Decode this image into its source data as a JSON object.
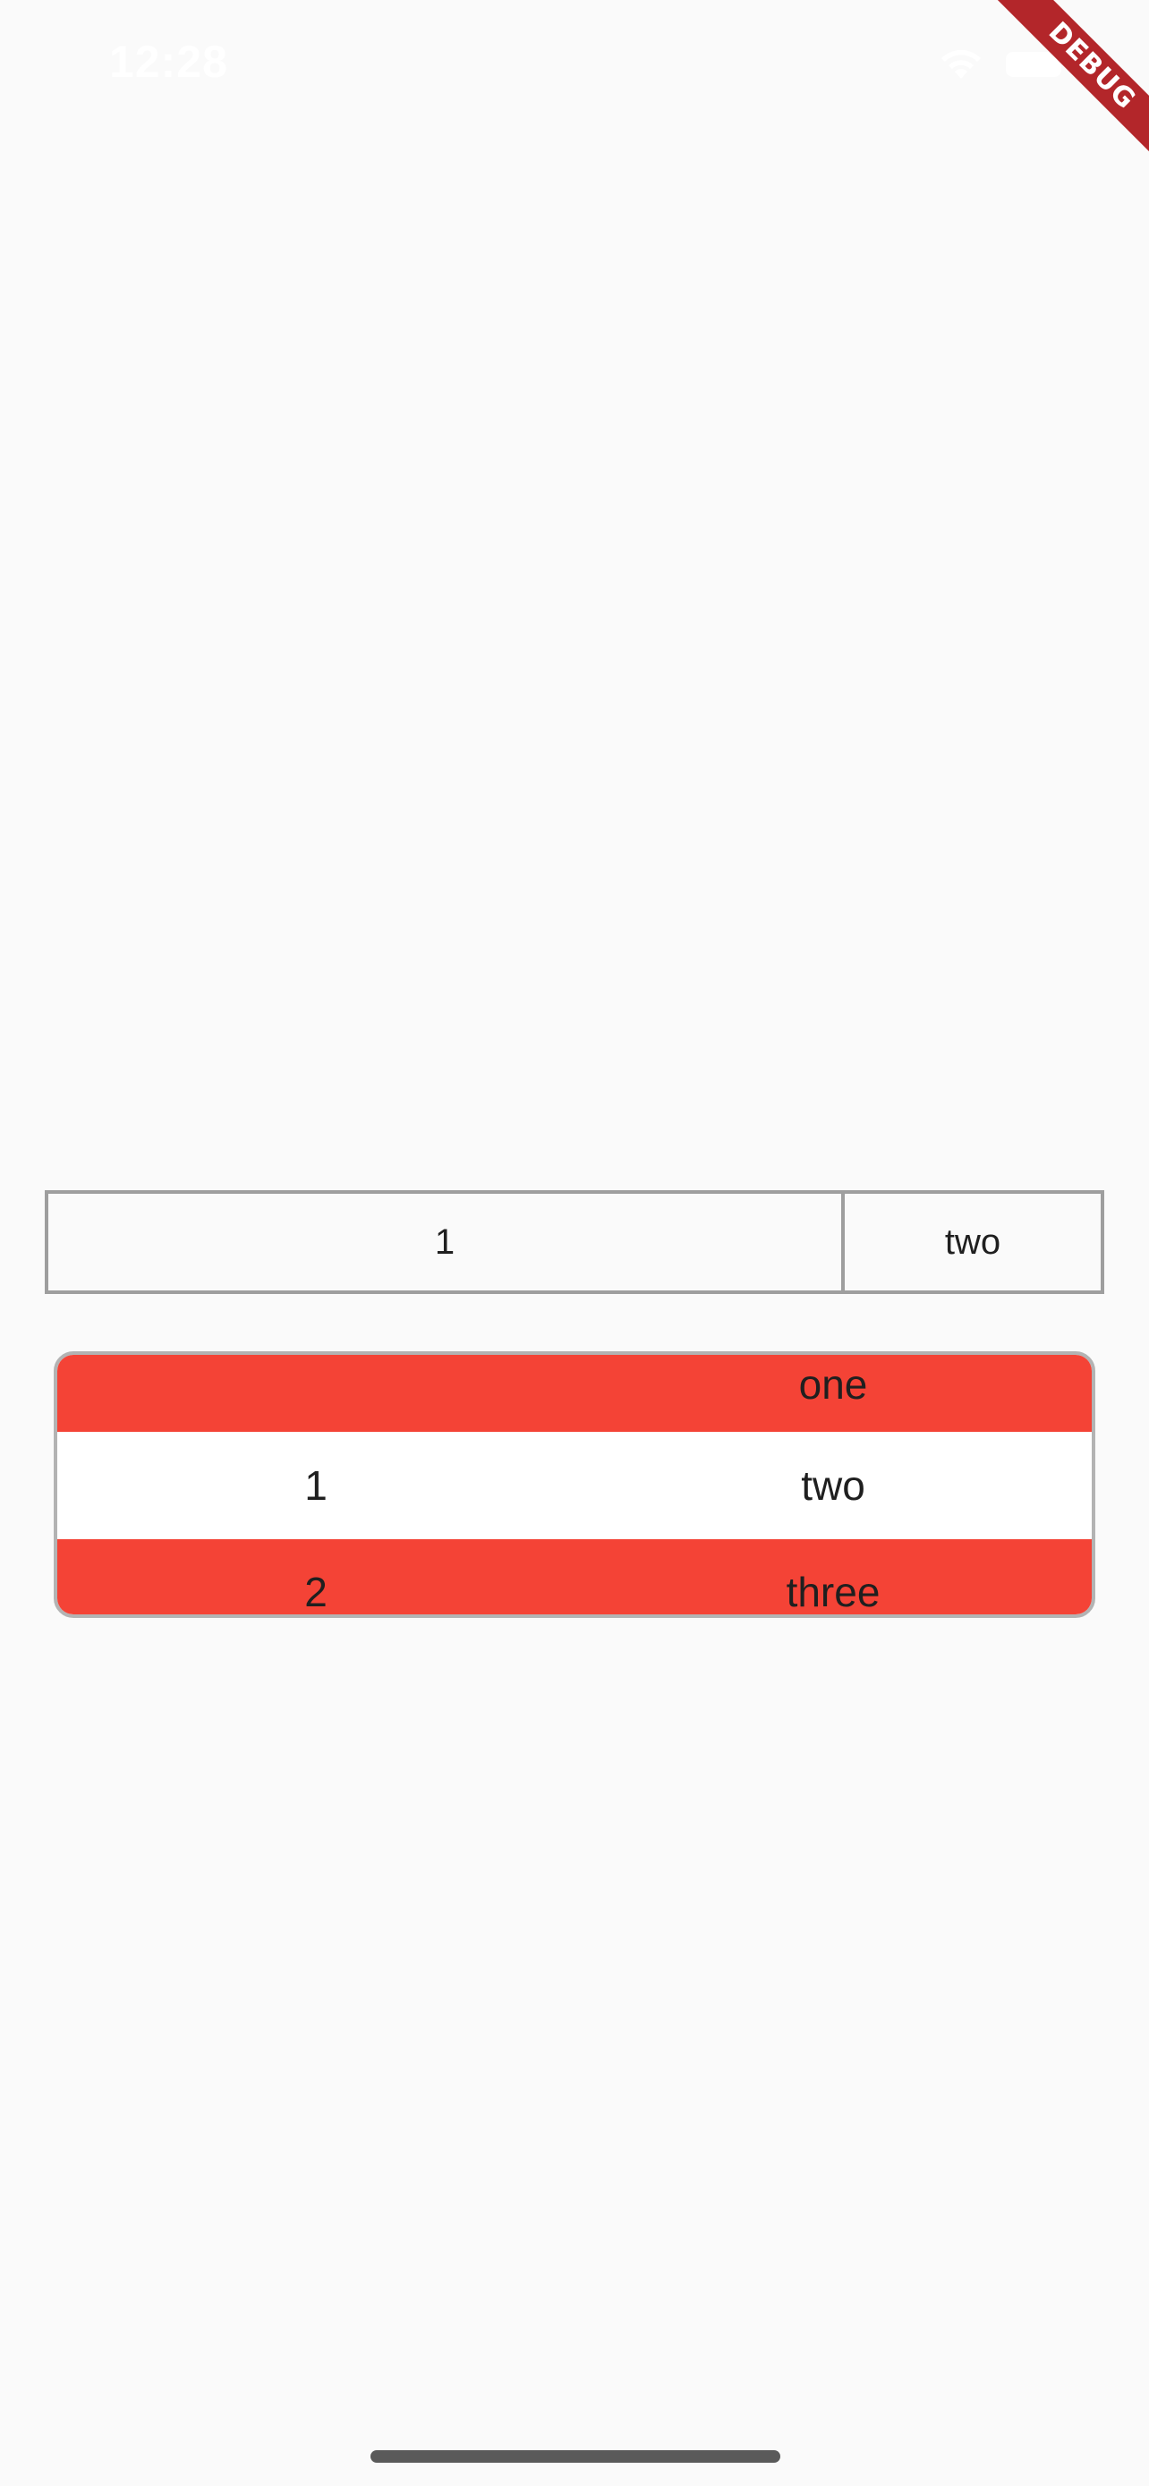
{
  "status_bar": {
    "time": "12:28",
    "wifi_icon": "wifi-icon",
    "battery_icon": "battery-icon"
  },
  "debug_banner": {
    "label": "DEBUG",
    "color": "#b3262a"
  },
  "table_one": {
    "cells": [
      "1",
      "two"
    ],
    "border_color": "#9e9e9e"
  },
  "table_two": {
    "rows": [
      {
        "col1": "",
        "col2": "one",
        "background": "#f44336"
      },
      {
        "col1": "1",
        "col2": "two",
        "background": "#ffffff"
      },
      {
        "col1": "2",
        "col2": "three",
        "background": "#f44336"
      }
    ],
    "border_color": "#b3b3b3"
  }
}
